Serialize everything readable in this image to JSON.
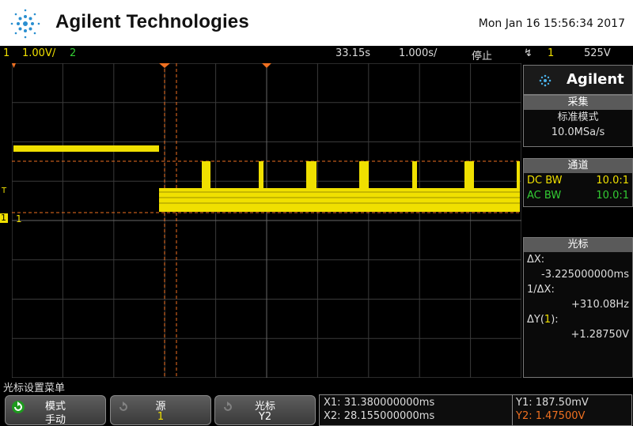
{
  "header": {
    "brand": "Agilent Technologies",
    "datetime": "Mon Jan 16 15:56:34 2017"
  },
  "status": {
    "ch1_num": "1",
    "ch1_scale": "1.00V/",
    "ch2_num": "2",
    "time_pos": "33.15s",
    "time_scale": "1.000s/",
    "run_state": "停止",
    "trig_icon": "↯",
    "trig_src": "1",
    "trig_level": "525V"
  },
  "panel": {
    "logo": "Agilent",
    "acq_title": "采集",
    "acq_mode": "标准模式",
    "acq_rate": "10.0MSa/s",
    "ch_title": "通道",
    "ch1_coupling": "DC BW",
    "ch1_probe": "10.0:1",
    "ch2_coupling": "AC BW",
    "ch2_probe": "10.0:1",
    "cursor_title": "光标",
    "dx_label": "ΔX:",
    "dx_value": "-3.225000000ms",
    "inv_dx_label": "1/ΔX:",
    "inv_dx_value": "+310.08Hz",
    "dy_label": "ΔY(",
    "dy_ch": "1",
    "dy_label_end": "):",
    "dy_value": "+1.28750V"
  },
  "softkeys": {
    "menu_title": "光标设置菜单",
    "mode_label": "模式",
    "mode_value": "手动",
    "source_label": "源",
    "source_value": "1",
    "cursor_label": "光标",
    "cursor_value": "Y2"
  },
  "cursor_readout": {
    "x1": "X1: 31.380000000ms",
    "x2": "X2: 28.155000000ms",
    "y1": "Y1: 187.50mV",
    "y2": "Y2: 1.47500V"
  },
  "markers": {
    "trig_T": "T",
    "ch1_marker": "1",
    "ch1_label": "1"
  },
  "colors": {
    "ch1": "#f0e000",
    "ch2": "#33cc33",
    "cursor": "#f07020",
    "panel_header": "#5a5a5a"
  }
}
